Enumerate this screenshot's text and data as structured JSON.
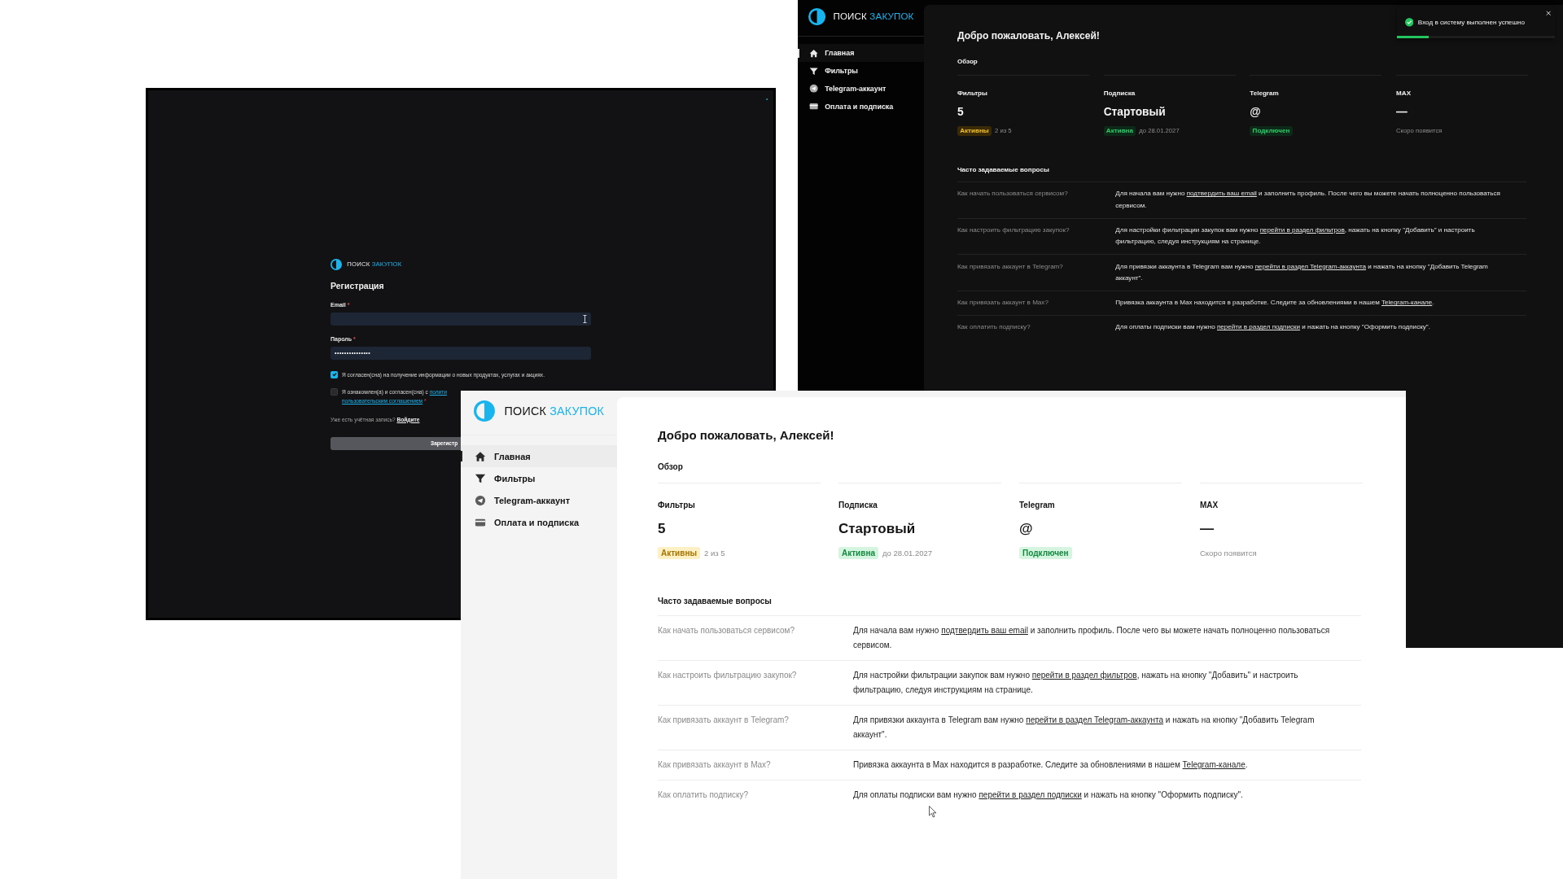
{
  "registration": {
    "logo": {
      "word1": "ПОИСК",
      "word2": "ЗАКУПОК"
    },
    "title": "Регистрация",
    "fields": [
      {
        "kind": "email",
        "label": "Email",
        "required_mark": "*"
      },
      {
        "kind": "password",
        "label": "Пароль",
        "required_mark": "*",
        "value": "•••••••••••••••"
      }
    ],
    "checkboxes": [
      {
        "text": "Я согласен(сна) на получение информации о новых продуктах, услугах и акциях.",
        "checked": true
      },
      {
        "text": "Я ознакомлен(а) и согласен(сна) с ",
        "links": [
          "полити",
          "пользовательским соглашением"
        ],
        "required_mark": "*",
        "checked": false
      }
    ],
    "login_prompt": "Уже есть учётная запись?",
    "login_link": "Войдите",
    "submit": "Зарегистр"
  },
  "dashboards": [
    {
      "kind": "dark",
      "logo": {
        "word1": "ПОИСК",
        "word2": "ЗАКУПОК"
      },
      "nav": [
        {
          "label": "Главная",
          "selected": true
        },
        {
          "label": "Фильтры",
          "selected": false
        },
        {
          "label": "Telegram-аккаунт",
          "selected": false
        },
        {
          "label": "Оплата и подписка",
          "selected": false
        }
      ],
      "heading": "Добро пожаловать, Алексей!",
      "overview": "Обзор",
      "stats": [
        {
          "label": "Фильтры",
          "value": "5",
          "badge": {
            "kind": "warning",
            "text": "Активны"
          },
          "note": "2 из 5"
        },
        {
          "label": "Подписка",
          "value": "Стартовый",
          "badge": {
            "kind": "success",
            "text": "Активна"
          },
          "note": "до 28.01.2027"
        },
        {
          "label": "Telegram",
          "value": "@",
          "badge": {
            "kind": "success",
            "text": "Подключен"
          }
        },
        {
          "label": "MAX",
          "value": "—",
          "note": "Скоро появится"
        }
      ],
      "faq_title": "Часто задаваемые вопросы",
      "faq": [
        {
          "question": "Как начать пользоваться сервисом?",
          "before": "Для начала вам нужно ",
          "link": "подтвердить ваш email",
          "after": " и заполнить профиль. После чего вы можете начать полноценно пользоваться сервисом."
        },
        {
          "question": "Как настроить фильтрацию закупок?",
          "before": "Для настройки фильтрации закупок вам нужно ",
          "link": "перейти в раздел фильтров",
          "after": ", нажать на кнопку \"Добавить\" и настроить фильтрацию, следуя инструкциям на странице."
        },
        {
          "question": "Как привязать аккаунт в Telegram?",
          "before": "Для привязки аккаунта в Telegram вам нужно ",
          "link": "перейти в раздел Telegram-аккаунта",
          "after": " и нажать на кнопку \"Добавить Telegram аккаунт\"."
        },
        {
          "question": "Как привязать аккаунт в Max?",
          "before": "Привязка аккаунта в Max находится в разработке. Следите за обновлениями в нашем ",
          "link": "Telegram-канале",
          "after": "."
        },
        {
          "question": "Как оплатить подписку?",
          "before": "Для оплаты подписки вам нужно ",
          "link": "перейти в раздел подписки",
          "after": " и нажать на кнопку \"Оформить подписку\"."
        }
      ],
      "toast": {
        "text": "Вход в систему выполнен успешно",
        "level": 0.2
      }
    },
    {
      "kind": "light",
      "logo": {
        "word1": "ПОИСК",
        "word2": "ЗАКУПОК"
      },
      "nav": [
        {
          "label": "Главная",
          "selected": true
        },
        {
          "label": "Фильтры",
          "selected": false
        },
        {
          "label": "Telegram-аккаунт",
          "selected": false
        },
        {
          "label": "Оплата и подписка",
          "selected": false
        }
      ],
      "heading": "Добро пожаловать, Алексей!",
      "overview": "Обзор",
      "stats": [
        {
          "label": "Фильтры",
          "value": "5",
          "badge": {
            "kind": "warning",
            "text": "Активны"
          },
          "note": "2 из 5"
        },
        {
          "label": "Подписка",
          "value": "Стартовый",
          "badge": {
            "kind": "success",
            "text": "Активна"
          },
          "note": "до 28.01.2027"
        },
        {
          "label": "Telegram",
          "value": "@",
          "badge": {
            "kind": "success",
            "text": "Подключен"
          }
        },
        {
          "label": "MAX",
          "value": "—",
          "note": "Скоро появится"
        }
      ],
      "faq_title": "Часто задаваемые вопросы",
      "faq": [
        {
          "question": "Как начать пользоваться сервисом?",
          "before": "Для начала вам нужно ",
          "link": "подтвердить ваш email",
          "after": " и заполнить профиль. После чего вы можете начать полноценно пользоваться сервисом."
        },
        {
          "question": "Как настроить фильтрацию закупок?",
          "before": "Для настройки фильтрации закупок вам нужно ",
          "link": "перейти в раздел фильтров",
          "after": ", нажать на кнопку \"Добавить\" и настроить фильтрацию, следуя инструкциям на странице."
        },
        {
          "question": "Как привязать аккаунт в Telegram?",
          "before": "Для привязки аккаунта в Telegram вам нужно ",
          "link": "перейти в раздел Telegram-аккаунта",
          "after": " и нажать на кнопку \"Добавить Telegram аккаунт\"."
        },
        {
          "question": "Как привязать аккаунт в Max?",
          "before": "Привязка аккаунта в Max находится в разработке. Следите за обновлениями в нашем ",
          "link": "Telegram-канале",
          "after": "."
        },
        {
          "question": "Как оплатить подписку?",
          "before": "Для оплаты подписки вам нужно ",
          "link": "перейти в раздел подписки",
          "after": " и нажать на кнопку \"Оформить подписку\"."
        }
      ]
    }
  ]
}
